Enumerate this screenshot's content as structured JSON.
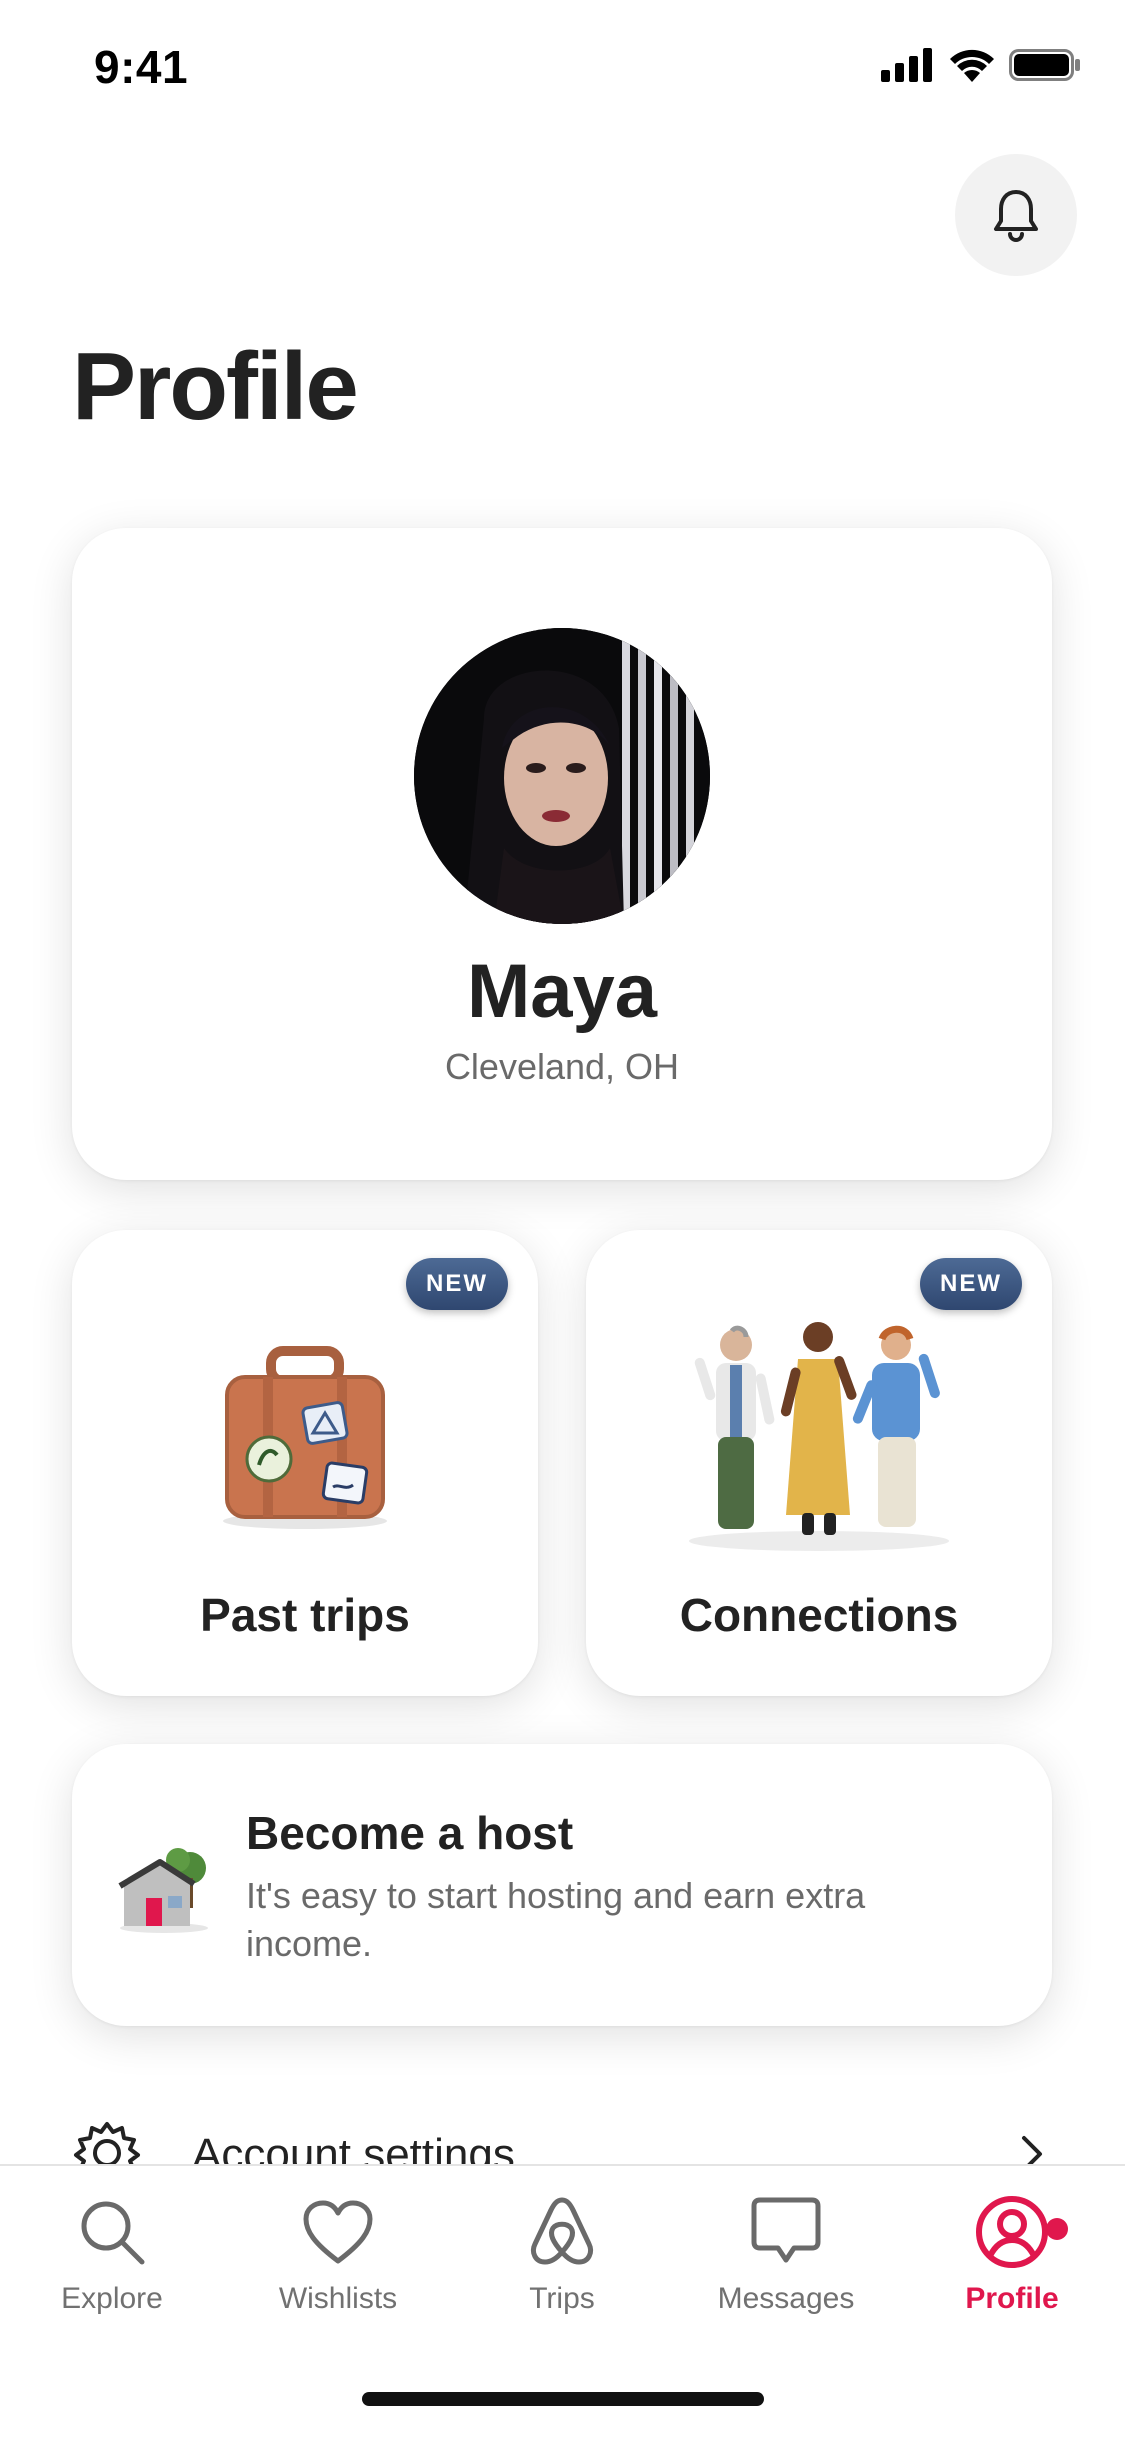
{
  "status_bar": {
    "time": "9:41"
  },
  "header": {
    "title": "Profile"
  },
  "profile": {
    "name": "Maya",
    "location": "Cleveland, OH"
  },
  "tiles": [
    {
      "label": "Past trips",
      "badge": "NEW",
      "icon": "suitcase-illustration"
    },
    {
      "label": "Connections",
      "badge": "NEW",
      "icon": "people-illustration"
    }
  ],
  "host": {
    "title": "Become a host",
    "text": "It's easy to start hosting and earn extra income.",
    "icon": "house-illustration"
  },
  "settings": {
    "label": "Account settings",
    "icon": "gear-icon"
  },
  "tabbar": {
    "items": [
      {
        "label": "Explore",
        "icon": "search-icon"
      },
      {
        "label": "Wishlists",
        "icon": "heart-icon"
      },
      {
        "label": "Trips",
        "icon": "airbnb-logo-icon"
      },
      {
        "label": "Messages",
        "icon": "message-icon"
      },
      {
        "label": "Profile",
        "icon": "profile-icon",
        "active": true
      }
    ]
  },
  "colors": {
    "accent": "#e0174d",
    "badge": "#3d5782",
    "muted": "#6a6a6a"
  }
}
